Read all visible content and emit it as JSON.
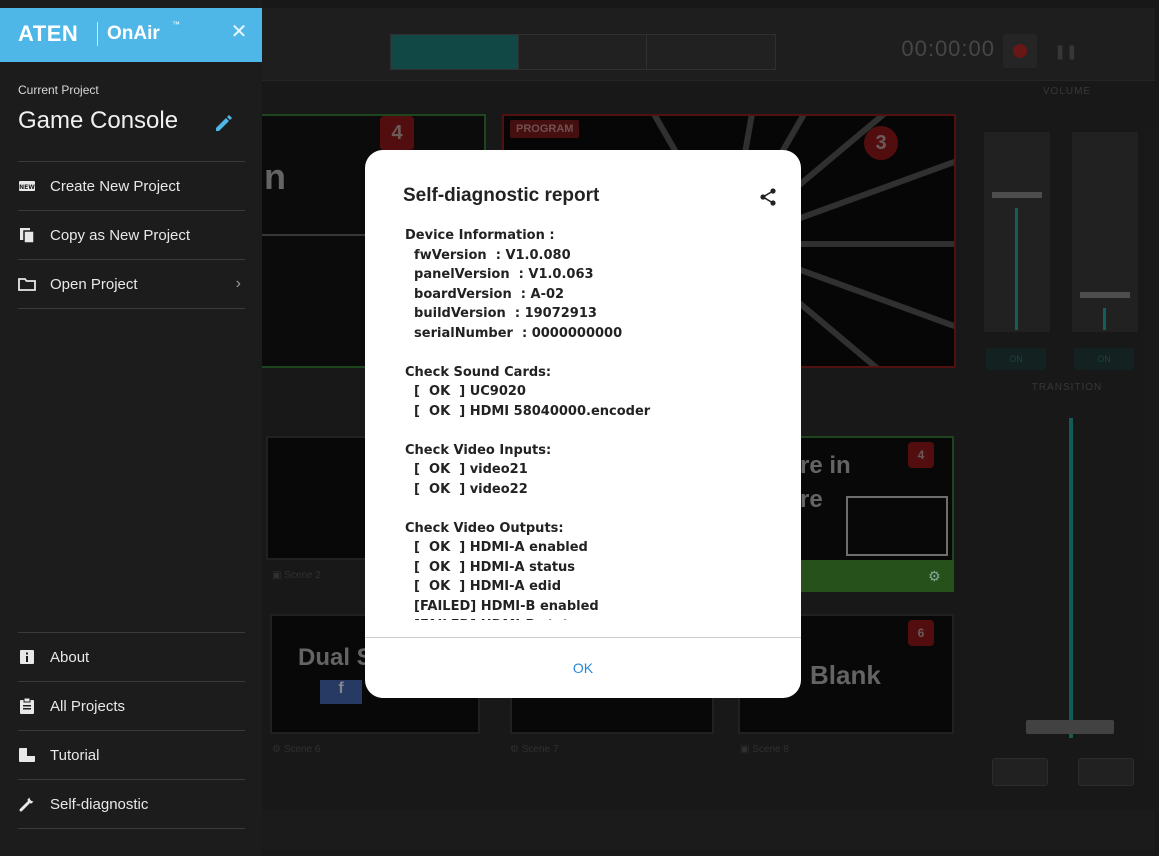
{
  "drawer": {
    "logo": {
      "brand": "ATEN",
      "product": "OnAir",
      "tm": "™"
    },
    "close_label": "✕",
    "current_project_label": "Current Project",
    "current_project_name": "Game Console",
    "items_top": [
      {
        "label": "Create New Project",
        "icon": "new-icon"
      },
      {
        "label": "Copy as New Project",
        "icon": "copy-icon"
      },
      {
        "label": "Open Project",
        "icon": "folder-icon"
      }
    ],
    "items_bottom": [
      {
        "label": "About",
        "icon": "info-icon"
      },
      {
        "label": "All Projects",
        "icon": "clipboard-icon"
      },
      {
        "label": "Tutorial",
        "icon": "tutorial-icon"
      },
      {
        "label": "Self-diagnostic",
        "icon": "wrench-icon"
      }
    ]
  },
  "background": {
    "timer": "00:00:00",
    "preview_number": "4",
    "program_tag": "PROGRAM",
    "program_number": "3",
    "scene_badges": [
      "4",
      "6"
    ],
    "scene_texts": [
      "Dual S",
      "Blank",
      "re in",
      "re"
    ],
    "volume_label": "VOLUME",
    "transition_label": "TRANSITION",
    "on_label": "ON"
  },
  "modal": {
    "title": "Self-diagnostic report",
    "lines": [
      "Device Information :",
      "  fwVersion  : V1.0.080",
      "  panelVersion  : V1.0.063",
      "  boardVersion  : A-02",
      "  buildVersion  : 19072913",
      "  serialNumber  : 0000000000",
      "",
      "Check Sound Cards:",
      "  [  OK  ] UC9020",
      "  [  OK  ] HDMI 58040000.encoder",
      "",
      "Check Video Inputs:",
      "  [  OK  ] video21",
      "  [  OK  ] video22",
      "",
      "Check Video Outputs:",
      "  [  OK  ] HDMI-A enabled",
      "  [  OK  ] HDMI-A status",
      "  [  OK  ] HDMI-A edid",
      "  [FAILED] HDMI-B enabled",
      "  [FAILED] HDMI-B status"
    ],
    "ok_label": "OK"
  },
  "colors": {
    "accent": "#4fb7e8",
    "link": "#2b87d6",
    "teal": "#1c8d88"
  }
}
